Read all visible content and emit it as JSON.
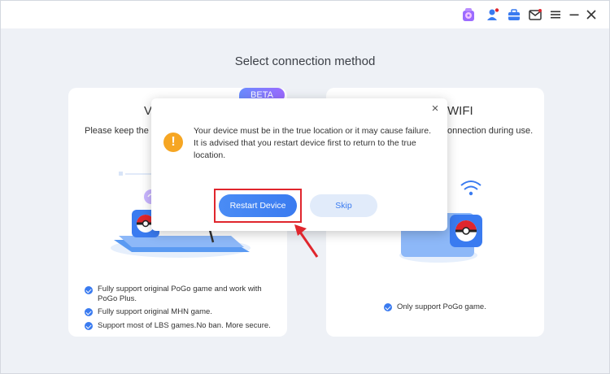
{
  "page": {
    "title": "Select connection method"
  },
  "cards": {
    "left": {
      "title": "V",
      "subtitle": "Please keep the B",
      "badge": "BETA",
      "features": [
        "Fully support original PoGo game and work with PoGo Plus.",
        "Fully support original MHN game.",
        "Support most of LBS games.No ban. More secure."
      ]
    },
    "right": {
      "title": "WIFI",
      "subtitle": "onnection during use.",
      "features": [
        "Only support PoGo game."
      ]
    }
  },
  "dialog": {
    "message": "Your device must be in the true location or it may cause failure. It is advised that you restart device first to return to the true location.",
    "restart_label": "Restart Device",
    "skip_label": "Skip",
    "close_glyph": "×",
    "warning_glyph": "!"
  },
  "titlebar": {
    "icons": [
      "gift-icon",
      "user-icon",
      "toolbox-icon",
      "mail-icon",
      "menu-icon",
      "minimize-icon",
      "close-icon"
    ]
  },
  "colors": {
    "accent": "#3a7bf0",
    "highlight": "#e0262d",
    "warning": "#f6a623"
  }
}
